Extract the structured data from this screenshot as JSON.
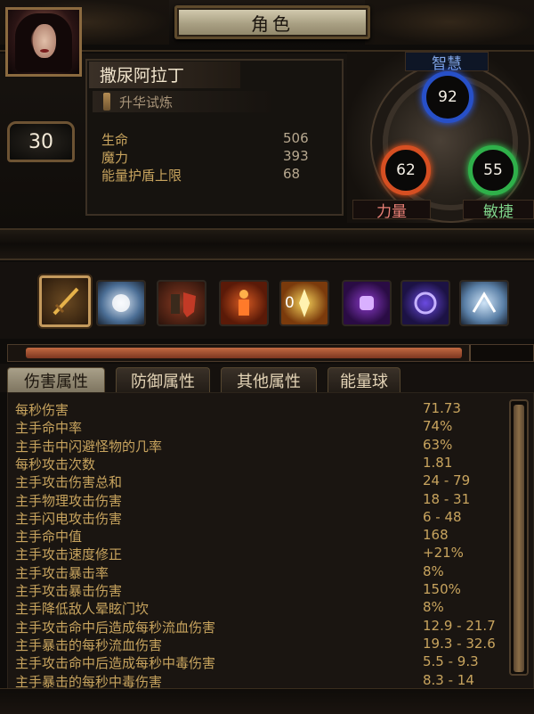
{
  "header": {
    "title": "角色"
  },
  "character": {
    "name": "撒尿阿拉丁",
    "class": "升华试炼",
    "level": "30",
    "stats": [
      {
        "label": "生命",
        "value": "506"
      },
      {
        "label": "魔力",
        "value": "393"
      },
      {
        "label": "能量护盾上限",
        "value": "68"
      }
    ]
  },
  "attributes": {
    "intelligence": {
      "label": "智慧",
      "value": "92",
      "color": "#2750c8"
    },
    "strength": {
      "label": "力量",
      "value": "62",
      "color": "#d64f22"
    },
    "dexterity": {
      "label": "敏捷",
      "value": "55",
      "color": "#2fb04a"
    }
  },
  "skills": [
    {
      "icon": "sword-icon",
      "badge": ""
    },
    {
      "icon": "ice-nova-icon",
      "badge": ""
    },
    {
      "icon": "shield-warrior-icon",
      "badge": ""
    },
    {
      "icon": "fire-body-icon",
      "badge": ""
    },
    {
      "icon": "fire-strike-icon",
      "badge": "0"
    },
    {
      "icon": "fist-aura-icon",
      "badge": ""
    },
    {
      "icon": "hand-aura-icon",
      "badge": ""
    },
    {
      "icon": "dash-icon",
      "badge": ""
    }
  ],
  "progress": {
    "fraction": 0.86
  },
  "tabs": [
    {
      "label": "伤害属性"
    },
    {
      "label": "防御属性"
    },
    {
      "label": "其他属性"
    },
    {
      "label": "能量球"
    }
  ],
  "damage_stats": [
    {
      "label": "每秒伤害",
      "value": "71.73"
    },
    {
      "label": "主手命中率",
      "value": "74%"
    },
    {
      "label": "主手击中闪避怪物的几率",
      "value": "63%"
    },
    {
      "label": "每秒攻击次数",
      "value": "1.81"
    },
    {
      "label": "主手攻击伤害总和",
      "value": "24 - 79"
    },
    {
      "label": "主手物理攻击伤害",
      "value": "18 - 31"
    },
    {
      "label": "主手闪电攻击伤害",
      "value": "6 - 48"
    },
    {
      "label": "主手命中值",
      "value": "168"
    },
    {
      "label": "主手攻击速度修正",
      "value": "+21%"
    },
    {
      "label": "主手攻击暴击率",
      "value": "8%"
    },
    {
      "label": "主手攻击暴击伤害",
      "value": "150%"
    },
    {
      "label": "主手降低敌人晕眩门坎",
      "value": "8%"
    },
    {
      "label": "主手攻击命中后造成每秒流血伤害",
      "value": "12.9 - 21.7"
    },
    {
      "label": "主手暴击的每秒流血伤害",
      "value": "19.3 - 32.6"
    },
    {
      "label": "主手攻击命中后造成每秒中毒伤害",
      "value": "5.5 - 9.3"
    },
    {
      "label": "主手暴击的每秒中毒伤害",
      "value": "8.3 - 14"
    }
  ]
}
